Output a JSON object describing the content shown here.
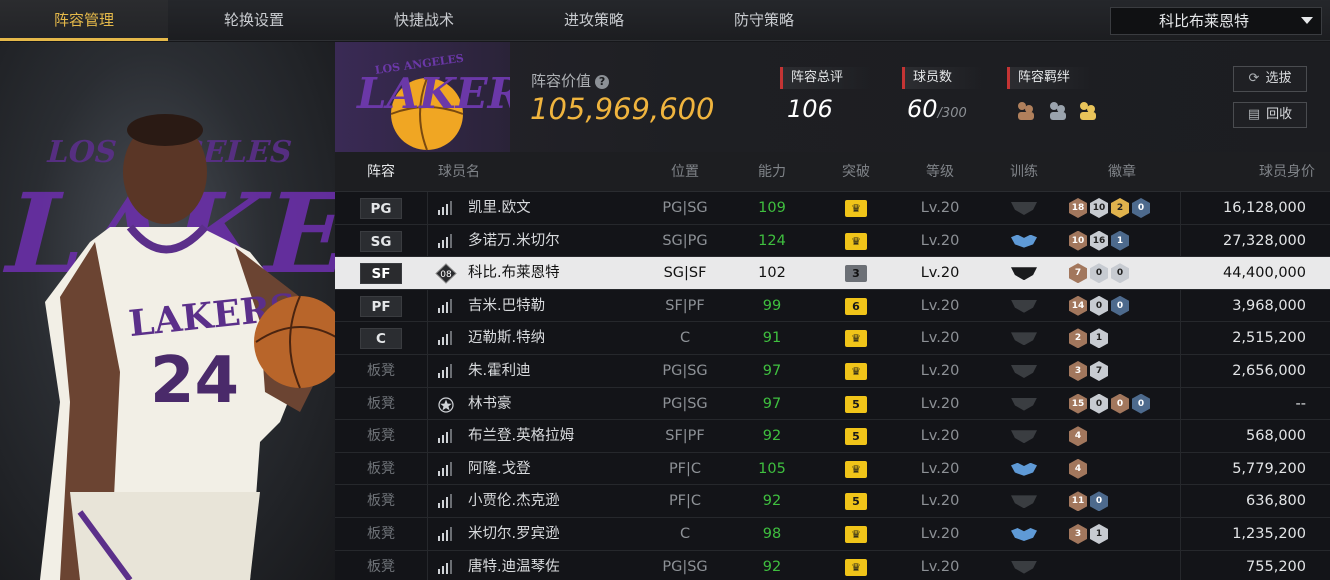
{
  "nav": {
    "tabs": [
      "阵容管理",
      "轮换设置",
      "快捷战术",
      "进攻策略",
      "防守策略"
    ],
    "active_tab": "阵容管理",
    "team_select": "科比布莱恩特"
  },
  "header": {
    "lineup_value_label": "阵容价值",
    "lineup_value": "105,969,600",
    "stats": [
      {
        "label": "阵容总评",
        "value": "106"
      },
      {
        "label": "球员数",
        "value": "60",
        "sub": "/300"
      },
      {
        "label": "阵容羁绊"
      }
    ],
    "buttons": {
      "pick": "选拔",
      "recycle": "回收"
    }
  },
  "table": {
    "columns": [
      "阵容",
      "球员名",
      "位置",
      "能力",
      "突破",
      "等级",
      "训练",
      "徽章",
      "球员身价"
    ],
    "rows": [
      {
        "slot": "PG",
        "starter": true,
        "name": "凯里.欧文",
        "pos": "PG|SG",
        "ability": "109",
        "breakthrough": "",
        "bk_type": "crown",
        "level": "Lv.20",
        "train": "none",
        "badges": [
          [
            "18",
            "b"
          ],
          [
            "10",
            "s"
          ],
          [
            "2",
            "g"
          ],
          [
            "0",
            "p"
          ]
        ],
        "value": "16,128,000"
      },
      {
        "slot": "SG",
        "starter": true,
        "name": "多诺万.米切尔",
        "pos": "SG|PG",
        "ability": "124",
        "breakthrough": "",
        "bk_type": "crown",
        "level": "Lv.20",
        "train": "blue",
        "badges": [
          [
            "10",
            "b"
          ],
          [
            "16",
            "s"
          ],
          [
            "1",
            "p"
          ]
        ],
        "value": "27,328,000"
      },
      {
        "slot": "SF",
        "starter": true,
        "selected": true,
        "name": "科比.布莱恩特",
        "pos": "SG|SF",
        "ability": "102",
        "breakthrough": "3",
        "bk_type": "grey",
        "level": "Lv.20",
        "train": "dark",
        "badges": [
          [
            "7",
            "b"
          ],
          [
            "0",
            "s"
          ],
          [
            "0",
            "s"
          ]
        ],
        "value": "44,400,000"
      },
      {
        "slot": "PF",
        "starter": true,
        "name": "吉米.巴特勒",
        "pos": "SF|PF",
        "ability": "99",
        "breakthrough": "6",
        "bk_type": "num",
        "level": "Lv.20",
        "train": "none",
        "badges": [
          [
            "14",
            "b"
          ],
          [
            "0",
            "s"
          ],
          [
            "0",
            "p"
          ]
        ],
        "value": "3,968,000"
      },
      {
        "slot": "C",
        "starter": true,
        "name": "迈勒斯.特纳",
        "pos": "C",
        "ability": "91",
        "breakthrough": "",
        "bk_type": "crown",
        "level": "Lv.20",
        "train": "none",
        "badges": [
          [
            "2",
            "b"
          ],
          [
            "1",
            "s"
          ]
        ],
        "value": "2,515,200"
      },
      {
        "slot": "板凳",
        "starter": false,
        "name": "朱.霍利迪",
        "pos": "PG|SG",
        "ability": "97",
        "breakthrough": "",
        "bk_type": "crown",
        "level": "Lv.20",
        "train": "none",
        "badges": [
          [
            "3",
            "b"
          ],
          [
            "7",
            "s"
          ]
        ],
        "value": "2,656,000"
      },
      {
        "slot": "板凳",
        "starter": false,
        "name": "林书豪",
        "pos": "PG|SG",
        "ability": "97",
        "breakthrough": "5",
        "bk_type": "num",
        "level": "Lv.20",
        "train": "none",
        "badges": [
          [
            "15",
            "b"
          ],
          [
            "0",
            "s"
          ],
          [
            "0",
            "b"
          ],
          [
            "0",
            "p"
          ]
        ],
        "value": "--"
      },
      {
        "slot": "板凳",
        "starter": false,
        "name": "布兰登.英格拉姆",
        "pos": "SF|PF",
        "ability": "92",
        "breakthrough": "5",
        "bk_type": "num",
        "level": "Lv.20",
        "train": "none",
        "badges": [
          [
            "4",
            "b"
          ]
        ],
        "value": "568,000"
      },
      {
        "slot": "板凳",
        "starter": false,
        "name": "阿隆.戈登",
        "pos": "PF|C",
        "ability": "105",
        "breakthrough": "",
        "bk_type": "crown",
        "level": "Lv.20",
        "train": "blue",
        "badges": [
          [
            "4",
            "b"
          ]
        ],
        "value": "5,779,200"
      },
      {
        "slot": "板凳",
        "starter": false,
        "name": "小贾伦.杰克逊",
        "pos": "PF|C",
        "ability": "92",
        "breakthrough": "5",
        "bk_type": "num",
        "level": "Lv.20",
        "train": "none",
        "badges": [
          [
            "11",
            "b"
          ],
          [
            "0",
            "p"
          ]
        ],
        "value": "636,800"
      },
      {
        "slot": "板凳",
        "starter": false,
        "name": "米切尔.罗宾逊",
        "pos": "C",
        "ability": "98",
        "breakthrough": "",
        "bk_type": "crown",
        "level": "Lv.20",
        "train": "blue",
        "badges": [
          [
            "3",
            "b"
          ],
          [
            "1",
            "s"
          ]
        ],
        "value": "1,235,200"
      },
      {
        "slot": "板凳",
        "starter": false,
        "name": "唐特.迪温琴佐",
        "pos": "PG|SG",
        "ability": "92",
        "breakthrough": "",
        "bk_type": "crown",
        "level": "Lv.20",
        "train": "none",
        "badges": [],
        "value": "755,200"
      }
    ]
  },
  "colors": {
    "accent": "#e5b94a",
    "ability": "#3fbf3f",
    "breakthrough": "#f0c419",
    "stat_marker": "#c43434"
  }
}
